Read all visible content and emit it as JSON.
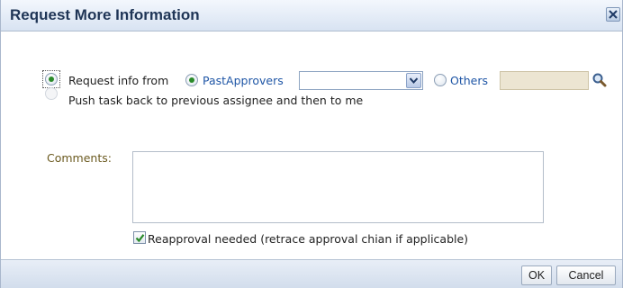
{
  "dialog": {
    "title": "Request More Information",
    "close_icon": "close-icon"
  },
  "form": {
    "request_info_label": "Request info from",
    "past_approvers_label": "PastApprovers",
    "approver_select_value": "",
    "others_label": "Others",
    "others_input_value": "",
    "push_back_label": "Push task back to previous assignee and then to me",
    "comments_label": "Comments:",
    "comments_value": "",
    "reapproval_label": "Reapproval needed (retrace approval chian if applicable)",
    "reapproval_checked": true
  },
  "footer": {
    "ok_label": "OK",
    "cancel_label": "Cancel"
  },
  "colors": {
    "title_text": "#1f3556",
    "link_blue": "#1f56a6",
    "radio_selected": "#2a8a2a",
    "others_input_bg": "#ece5d2"
  }
}
